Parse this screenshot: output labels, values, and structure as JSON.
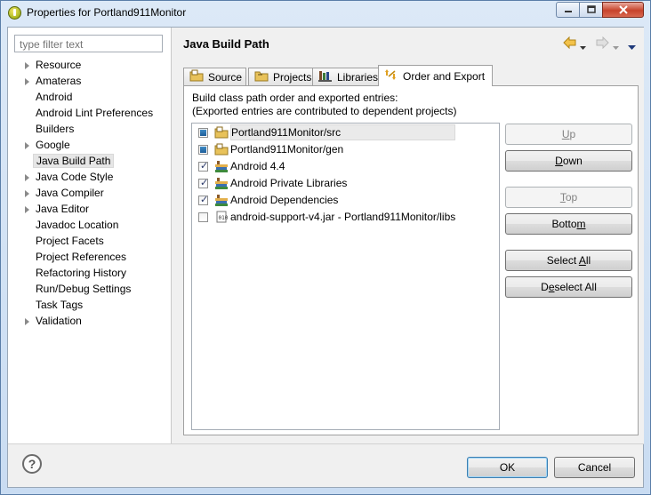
{
  "window": {
    "title": "Properties for Portland911Monitor"
  },
  "filter": {
    "placeholder": "type filter text"
  },
  "tree": {
    "items": [
      {
        "label": "Resource",
        "expandable": true
      },
      {
        "label": "Amateras",
        "expandable": true
      },
      {
        "label": "Android",
        "expandable": false
      },
      {
        "label": "Android Lint Preferences",
        "expandable": false
      },
      {
        "label": "Builders",
        "expandable": false
      },
      {
        "label": "Google",
        "expandable": true
      },
      {
        "label": "Java Build Path",
        "expandable": false,
        "selected": true
      },
      {
        "label": "Java Code Style",
        "expandable": true
      },
      {
        "label": "Java Compiler",
        "expandable": true
      },
      {
        "label": "Java Editor",
        "expandable": true
      },
      {
        "label": "Javadoc Location",
        "expandable": false
      },
      {
        "label": "Project Facets",
        "expandable": false
      },
      {
        "label": "Project References",
        "expandable": false
      },
      {
        "label": "Refactoring History",
        "expandable": false
      },
      {
        "label": "Run/Debug Settings",
        "expandable": false
      },
      {
        "label": "Task Tags",
        "expandable": false
      },
      {
        "label": "Validation",
        "expandable": true
      }
    ]
  },
  "page": {
    "title": "Java Build Path",
    "tabs": [
      {
        "label": "Source",
        "icon": "source-folder-icon"
      },
      {
        "label": "Projects",
        "icon": "projects-icon"
      },
      {
        "label": "Libraries",
        "icon": "libraries-icon"
      },
      {
        "label": "Order and Export",
        "icon": "order-export-icon",
        "active": true
      }
    ],
    "description_line1": "Build class path order and exported entries:",
    "description_line2": "(Exported entries are contributed to dependent projects)",
    "entries": [
      {
        "label": "Portland911Monitor/src",
        "state": "filled",
        "icon": "source-folder-icon",
        "selected": true
      },
      {
        "label": "Portland911Monitor/gen",
        "state": "filled",
        "icon": "source-folder-icon"
      },
      {
        "label": "Android 4.4",
        "state": "checked",
        "icon": "library-icon"
      },
      {
        "label": "Android Private Libraries",
        "state": "checked",
        "icon": "library-icon"
      },
      {
        "label": "Android Dependencies",
        "state": "checked",
        "icon": "library-icon"
      },
      {
        "label": "android-support-v4.jar - Portland911Monitor/libs",
        "state": "unchecked",
        "icon": "jar-icon"
      }
    ],
    "buttons": {
      "up": {
        "pre": "",
        "mn": "U",
        "post": "p"
      },
      "down": {
        "pre": "",
        "mn": "D",
        "post": "own"
      },
      "top": {
        "pre": "",
        "mn": "T",
        "post": "op"
      },
      "bottom": {
        "pre": "Botto",
        "mn": "m",
        "post": ""
      },
      "select_all": {
        "pre": "Select ",
        "mn": "A",
        "post": "ll"
      },
      "deselect_all": {
        "pre": "D",
        "mn": "e",
        "post": "select All"
      }
    }
  },
  "footer": {
    "ok": "OK",
    "cancel": "Cancel",
    "help_glyph": "?"
  },
  "colors": {
    "accent": "#3c7fb1",
    "close": "#c7432b"
  }
}
